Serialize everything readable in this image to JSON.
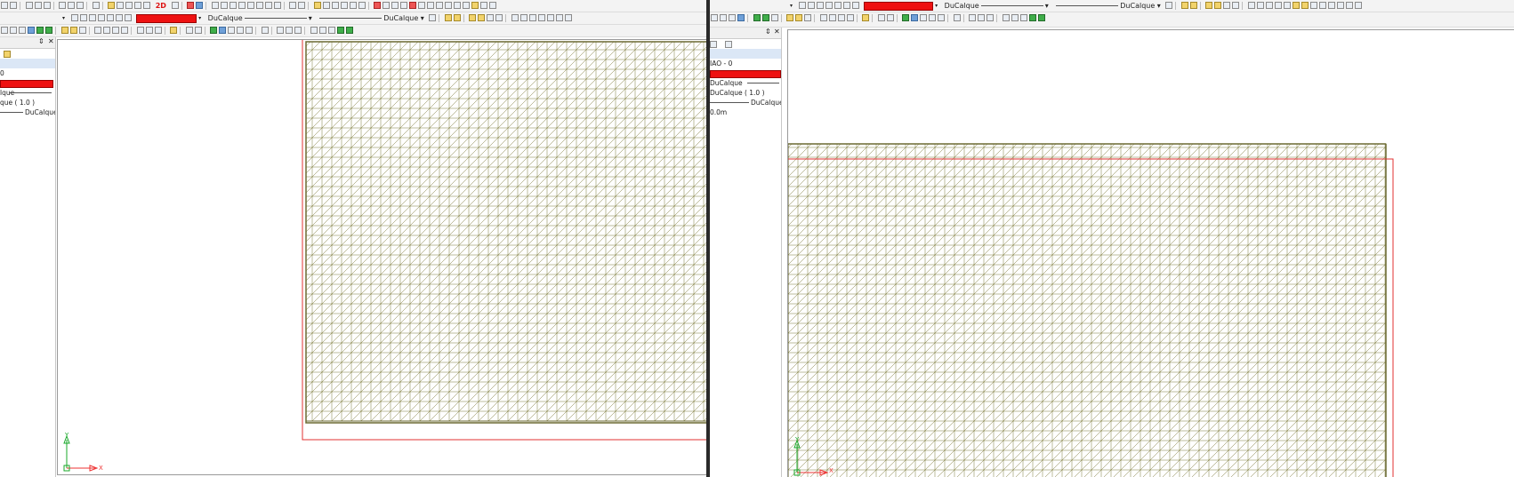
{
  "colors": {
    "mesh_line": "#7c7a3a",
    "boundary": "#e03030",
    "layer_color": "#ee1111",
    "ucs_green": "#19a82a",
    "ucs_red": "#e33"
  },
  "left_window": {
    "toolbar_text": {
      "mode_2d": "2D",
      "linetype_combo": "DuCalque",
      "lineweight_combo": "DuCalque"
    },
    "panel": {
      "row_layer_value": "0",
      "row_linetype_value": "lque",
      "row_scale_value": "que ( 1.0 )",
      "row_lineweight_value": "DuCalque"
    },
    "ucs": {
      "x": "X",
      "y": "Y"
    }
  },
  "right_window": {
    "toolbar_text": {
      "linetype_combo": "DuCalque",
      "lineweight_combo": "DuCalque"
    },
    "panel": {
      "row_layer_value": "IAO - 0",
      "row_linetype_value": "DuCalque",
      "row_scale_value": "DuCalque ( 1.0 )",
      "row_lineweight_value": "DuCalque",
      "row_thickness_value": "0.0m"
    },
    "ucs": {
      "x": "X",
      "y": "Y"
    }
  }
}
